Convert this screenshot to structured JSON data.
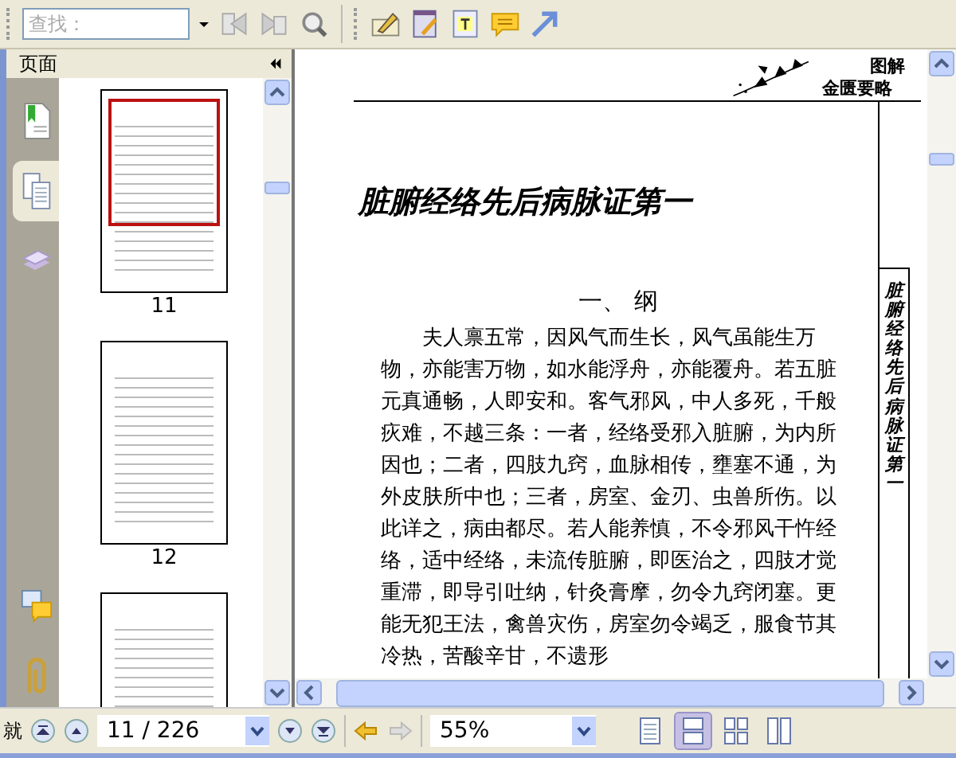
{
  "toolbar": {
    "search": {
      "placeholder": "查找："
    }
  },
  "sidebar": {
    "title": "页面",
    "tabs": [
      {
        "kind": "bookmarks",
        "selected": false
      },
      {
        "kind": "pages",
        "selected": true
      },
      {
        "kind": "layers",
        "selected": false
      },
      {
        "kind": "comments",
        "selected": false
      },
      {
        "kind": "attachments",
        "selected": false
      }
    ],
    "thumbnails": [
      {
        "label": "11",
        "selected": true
      },
      {
        "label": "12",
        "selected": false
      },
      {
        "selected": false
      }
    ]
  },
  "document": {
    "header_logo": [
      "图解",
      "金匮要略"
    ],
    "title": "脏腑经络先后病脉证第一",
    "section_heading": "一、 纲",
    "paragraph": "夫人禀五常，因风气而生长，风气虽能生万物，亦能害万物，如水能浮舟，亦能覆舟。若五脏元真通畅，人即安和。客气邪风，中人多死，千般疢难，不越三条：一者，经络受邪入脏腑，为内所因也；二者，四肢九窍，血脉相传，壅塞不通，为外皮肤所中也；三者，房室、金刃、虫兽所伤。以此详之，病由都尽。若人能养慎，不令邪风干忤经络，适中经络，未流传脏腑，即医治之，四肢才觉重滞，即导引吐纳，针灸膏摩，勿令九窍闭塞。更能无犯王法，禽兽灾伤，房室勿令竭乏，服食节其冷热，苦酸辛甘，不遗形",
    "side_title": "脏腑经络先后病脉证第一"
  },
  "status_bar": {
    "status": "就",
    "page": "11 / 226",
    "zoom": "55%",
    "view_modes": [
      {
        "kind": "single",
        "selected": false
      },
      {
        "kind": "continuous",
        "selected": true
      },
      {
        "kind": "facing",
        "selected": false
      },
      {
        "kind": "continuous-facing",
        "selected": false
      }
    ]
  }
}
